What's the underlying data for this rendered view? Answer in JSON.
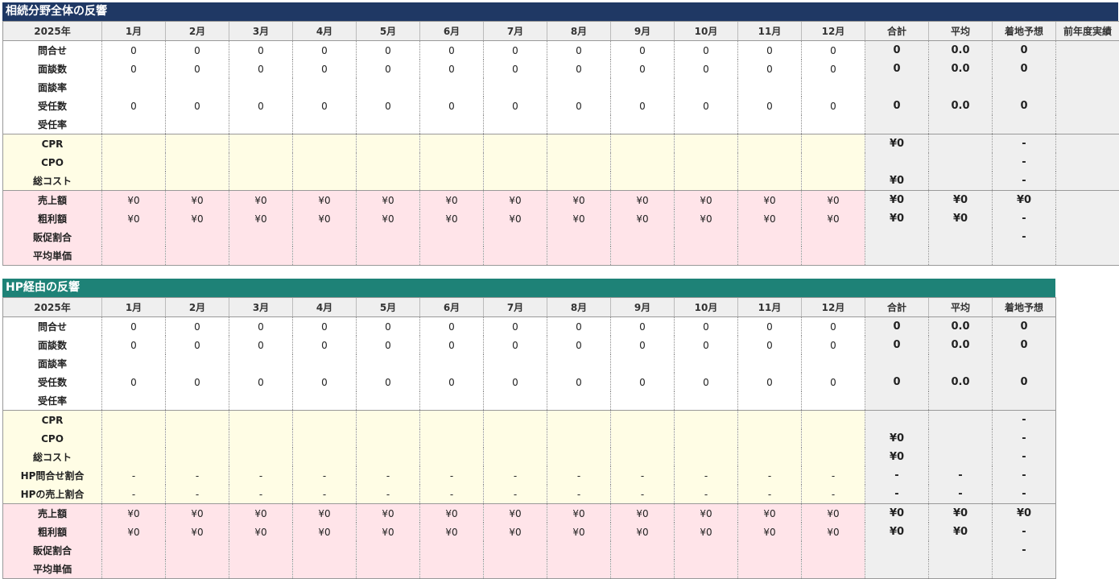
{
  "sections": [
    {
      "title": "相続分野全体の反響",
      "header": [
        "2025年",
        "1月",
        "2月",
        "3月",
        "4月",
        "5月",
        "6月",
        "7月",
        "8月",
        "9月",
        "10月",
        "11月",
        "12月",
        "合計",
        "平均",
        "着地予想",
        "前年度実績"
      ],
      "rows": [
        {
          "group": "white",
          "first": true,
          "label": "問合せ",
          "months": [
            "0",
            "0",
            "0",
            "0",
            "0",
            "0",
            "0",
            "0",
            "0",
            "0",
            "0",
            "0"
          ],
          "summary": [
            "0",
            "0.0",
            "0",
            ""
          ]
        },
        {
          "group": "white",
          "label": "面談数",
          "months": [
            "0",
            "0",
            "0",
            "0",
            "0",
            "0",
            "0",
            "0",
            "0",
            "0",
            "0",
            "0"
          ],
          "summary": [
            "0",
            "0.0",
            "0",
            ""
          ]
        },
        {
          "group": "white",
          "label": "面談率",
          "months": [
            "",
            "",
            "",
            "",
            "",
            "",
            "",
            "",
            "",
            "",
            "",
            ""
          ],
          "summary": [
            "",
            "",
            "",
            ""
          ]
        },
        {
          "group": "white",
          "label": "受任数",
          "months": [
            "0",
            "0",
            "0",
            "0",
            "0",
            "0",
            "0",
            "0",
            "0",
            "0",
            "0",
            "0"
          ],
          "summary": [
            "0",
            "0.0",
            "0",
            ""
          ]
        },
        {
          "group": "white",
          "last": true,
          "label": "受任率",
          "months": [
            "",
            "",
            "",
            "",
            "",
            "",
            "",
            "",
            "",
            "",
            "",
            ""
          ],
          "summary": [
            "",
            "",
            "",
            ""
          ]
        },
        {
          "group": "yellow",
          "first": true,
          "label": "CPR",
          "months": [
            "",
            "",
            "",
            "",
            "",
            "",
            "",
            "",
            "",
            "",
            "",
            ""
          ],
          "summary": [
            "¥0",
            "",
            "-",
            ""
          ]
        },
        {
          "group": "yellow",
          "label": "CPO",
          "months": [
            "",
            "",
            "",
            "",
            "",
            "",
            "",
            "",
            "",
            "",
            "",
            ""
          ],
          "summary": [
            "",
            "",
            "-",
            ""
          ]
        },
        {
          "group": "yellow",
          "last": true,
          "label": "総コスト",
          "months": [
            "",
            "",
            "",
            "",
            "",
            "",
            "",
            "",
            "",
            "",
            "",
            ""
          ],
          "summary": [
            "¥0",
            "",
            "-",
            ""
          ]
        },
        {
          "group": "pink",
          "first": true,
          "label": "売上額",
          "months": [
            "¥0",
            "¥0",
            "¥0",
            "¥0",
            "¥0",
            "¥0",
            "¥0",
            "¥0",
            "¥0",
            "¥0",
            "¥0",
            "¥0"
          ],
          "summary": [
            "¥0",
            "¥0",
            "¥0",
            ""
          ]
        },
        {
          "group": "pink",
          "label": "粗利額",
          "months": [
            "¥0",
            "¥0",
            "¥0",
            "¥0",
            "¥0",
            "¥0",
            "¥0",
            "¥0",
            "¥0",
            "¥0",
            "¥0",
            "¥0"
          ],
          "summary": [
            "¥0",
            "¥0",
            "-",
            ""
          ]
        },
        {
          "group": "pink",
          "label": "販促割合",
          "months": [
            "",
            "",
            "",
            "",
            "",
            "",
            "",
            "",
            "",
            "",
            "",
            ""
          ],
          "summary": [
            "",
            "",
            "-",
            ""
          ]
        },
        {
          "group": "pink",
          "last": true,
          "label": "平均単価",
          "months": [
            "",
            "",
            "",
            "",
            "",
            "",
            "",
            "",
            "",
            "",
            "",
            ""
          ],
          "summary": [
            "",
            "",
            "",
            ""
          ]
        }
      ]
    },
    {
      "title": "HP経由の反響",
      "header": [
        "2025年",
        "1月",
        "2月",
        "3月",
        "4月",
        "5月",
        "6月",
        "7月",
        "8月",
        "9月",
        "10月",
        "11月",
        "12月",
        "合計",
        "平均",
        "着地予想"
      ],
      "rows": [
        {
          "group": "white",
          "first": true,
          "label": "問合せ",
          "months": [
            "0",
            "0",
            "0",
            "0",
            "0",
            "0",
            "0",
            "0",
            "0",
            "0",
            "0",
            "0"
          ],
          "summary": [
            "0",
            "0.0",
            "0"
          ]
        },
        {
          "group": "white",
          "label": "面談数",
          "months": [
            "0",
            "0",
            "0",
            "0",
            "0",
            "0",
            "0",
            "0",
            "0",
            "0",
            "0",
            "0"
          ],
          "summary": [
            "0",
            "0.0",
            "0"
          ]
        },
        {
          "group": "white",
          "label": "面談率",
          "months": [
            "",
            "",
            "",
            "",
            "",
            "",
            "",
            "",
            "",
            "",
            "",
            ""
          ],
          "summary": [
            "",
            "",
            ""
          ]
        },
        {
          "group": "white",
          "label": "受任数",
          "months": [
            "0",
            "0",
            "0",
            "0",
            "0",
            "0",
            "0",
            "0",
            "0",
            "0",
            "0",
            "0"
          ],
          "summary": [
            "0",
            "0.0",
            "0"
          ]
        },
        {
          "group": "white",
          "last": true,
          "label": "受任率",
          "months": [
            "",
            "",
            "",
            "",
            "",
            "",
            "",
            "",
            "",
            "",
            "",
            ""
          ],
          "summary": [
            "",
            "",
            ""
          ]
        },
        {
          "group": "yellow",
          "first": true,
          "label": "CPR",
          "months": [
            "",
            "",
            "",
            "",
            "",
            "",
            "",
            "",
            "",
            "",
            "",
            ""
          ],
          "summary": [
            "",
            "",
            "-"
          ]
        },
        {
          "group": "yellow",
          "label": "CPO",
          "months": [
            "",
            "",
            "",
            "",
            "",
            "",
            "",
            "",
            "",
            "",
            "",
            ""
          ],
          "summary": [
            "¥0",
            "",
            "-"
          ]
        },
        {
          "group": "yellow",
          "label": "総コスト",
          "months": [
            "",
            "",
            "",
            "",
            "",
            "",
            "",
            "",
            "",
            "",
            "",
            ""
          ],
          "summary": [
            "¥0",
            "",
            "-"
          ]
        },
        {
          "group": "yellow",
          "label": "HP問合せ割合",
          "months": [
            "-",
            "-",
            "-",
            "-",
            "-",
            "-",
            "-",
            "-",
            "-",
            "-",
            "-",
            "-"
          ],
          "summary": [
            "-",
            "-",
            "-"
          ]
        },
        {
          "group": "yellow",
          "last": true,
          "label": "HPの売上割合",
          "months": [
            "-",
            "-",
            "-",
            "-",
            "-",
            "-",
            "-",
            "-",
            "-",
            "-",
            "-",
            "-"
          ],
          "summary": [
            "-",
            "-",
            "-"
          ]
        },
        {
          "group": "pink",
          "first": true,
          "label": "売上額",
          "months": [
            "¥0",
            "¥0",
            "¥0",
            "¥0",
            "¥0",
            "¥0",
            "¥0",
            "¥0",
            "¥0",
            "¥0",
            "¥0",
            "¥0"
          ],
          "summary": [
            "¥0",
            "¥0",
            "¥0"
          ]
        },
        {
          "group": "pink",
          "label": "粗利額",
          "months": [
            "¥0",
            "¥0",
            "¥0",
            "¥0",
            "¥0",
            "¥0",
            "¥0",
            "¥0",
            "¥0",
            "¥0",
            "¥0",
            "¥0"
          ],
          "summary": [
            "¥0",
            "¥0",
            "-"
          ]
        },
        {
          "group": "pink",
          "label": "販促割合",
          "months": [
            "",
            "",
            "",
            "",
            "",
            "",
            "",
            "",
            "",
            "",
            "",
            ""
          ],
          "summary": [
            "",
            "",
            "-"
          ]
        },
        {
          "group": "pink",
          "last": true,
          "label": "平均単価",
          "months": [
            "",
            "",
            "",
            "",
            "",
            "",
            "",
            "",
            "",
            "",
            "",
            ""
          ],
          "summary": [
            "",
            "",
            ""
          ]
        }
      ]
    }
  ]
}
